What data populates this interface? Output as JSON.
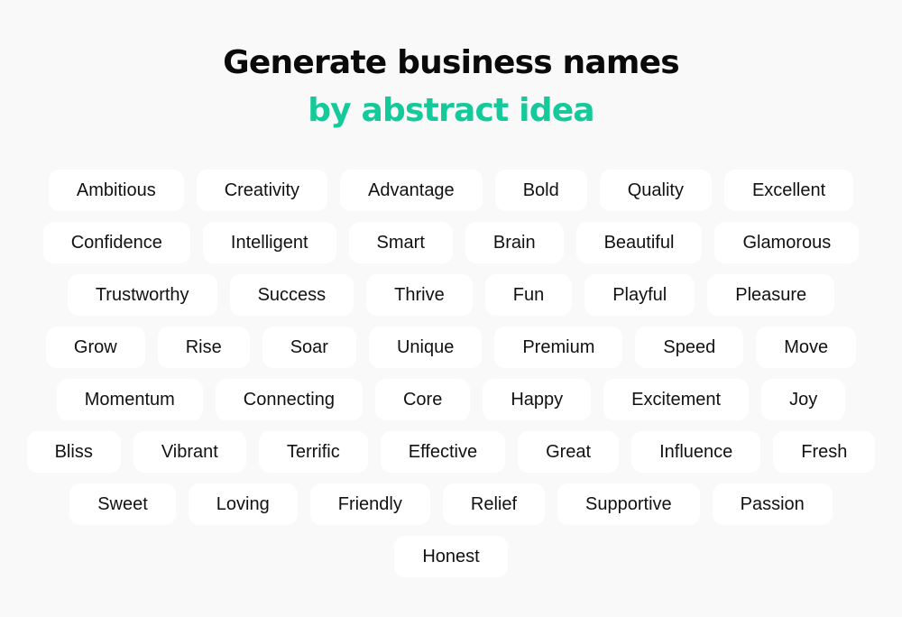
{
  "header": {
    "title": "Generate business names",
    "subtitle": "by abstract idea",
    "subtitle_color": "#14c99a"
  },
  "rows": [
    [
      "Ambitious",
      "Creativity",
      "Advantage",
      "Bold",
      "Quality",
      "Excellent"
    ],
    [
      "Confidence",
      "Intelligent",
      "Smart",
      "Brain",
      "Beautiful",
      "Glamorous"
    ],
    [
      "Trustworthy",
      "Success",
      "Thrive",
      "Fun",
      "Playful",
      "Pleasure"
    ],
    [
      "Grow",
      "Rise",
      "Soar",
      "Unique",
      "Premium",
      "Speed",
      "Move"
    ],
    [
      "Momentum",
      "Connecting",
      "Core",
      "Happy",
      "Excitement",
      "Joy"
    ],
    [
      "Bliss",
      "Vibrant",
      "Terrific",
      "Effective",
      "Great",
      "Influence",
      "Fresh"
    ],
    [
      "Sweet",
      "Loving",
      "Friendly",
      "Relief",
      "Supportive",
      "Passion"
    ],
    [
      "Honest"
    ]
  ]
}
